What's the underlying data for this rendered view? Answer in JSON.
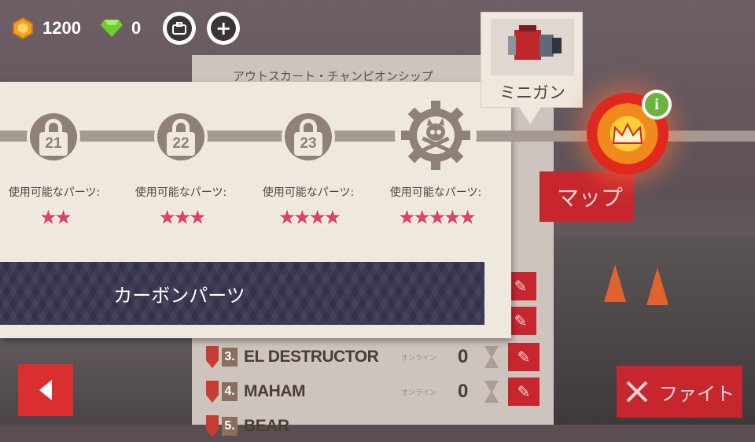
{
  "currency": {
    "coins": "1200",
    "gems": "0",
    "coin_icon": "hex-coin-icon",
    "gem_icon": "green-gem-icon"
  },
  "colors": {
    "accent_red": "#c7262f",
    "panel_bg": "#efe8df",
    "star": "#e2425b",
    "carbon": "#3d3a55"
  },
  "board": {
    "title": "アウトスカート・チャンピオンシップ",
    "rows": [
      {
        "rank": "3.",
        "name": "EL DESTRUCTOR",
        "status": "オンライン",
        "score": "0"
      },
      {
        "rank": "4.",
        "name": "MAHAM",
        "status": "オンライン",
        "score": "0"
      },
      {
        "rank": "5.",
        "name": "BEAR",
        "status": "",
        "score": ""
      }
    ]
  },
  "progression": {
    "levels": [
      {
        "number": "21",
        "available_label": "使用可能なパーツ:",
        "stars": 2
      },
      {
        "number": "22",
        "available_label": "使用可能なパーツ:",
        "stars": 3
      },
      {
        "number": "23",
        "available_label": "使用可能なパーツ:",
        "stars": 4
      },
      {
        "number": "",
        "available_label": "使用可能なパーツ:",
        "stars": 5
      }
    ],
    "leftmost_available_label": "使用可能なパーツ:",
    "leftmost_stars": 2,
    "parts_label": "カーボンパーツ"
  },
  "reward": {
    "label": "ミニガン",
    "icon": "minigun-icon"
  },
  "buttons": {
    "map": "マップ",
    "fight": "ファイト"
  }
}
